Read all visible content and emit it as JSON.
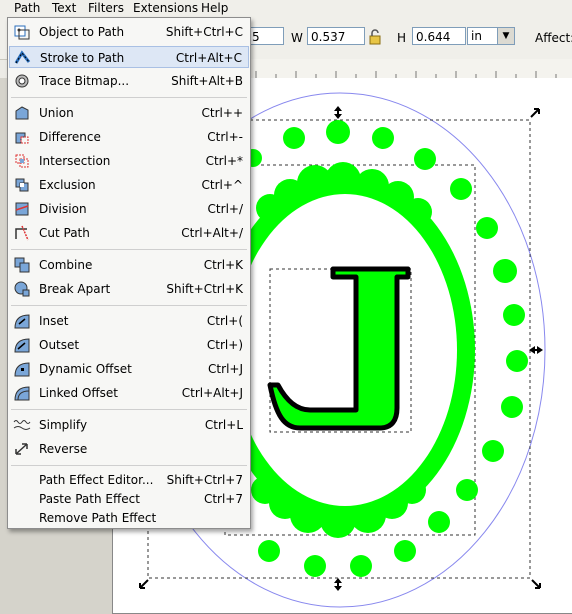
{
  "menubar": {
    "items": [
      {
        "label": "Path",
        "active": true
      },
      {
        "label": "Text"
      },
      {
        "label": "Filters"
      },
      {
        "label": "Extensions"
      },
      {
        "label": "Help"
      }
    ]
  },
  "toolbar": {
    "x_value": "5",
    "w_label": "W",
    "w_value": "0.537",
    "h_label": "H",
    "h_value": "0.644",
    "unit": "in",
    "affect_label": "Affect:"
  },
  "colors": {
    "accent_green": "#00ff00",
    "selection_highlight": "#dde7f5"
  },
  "menu": {
    "items": [
      {
        "label": "Object to Path",
        "shortcut": "Shift+Ctrl+C",
        "icon": "object-to-path-icon"
      },
      {
        "label": "Stroke to Path",
        "shortcut": "Ctrl+Alt+C",
        "icon": "stroke-to-path-icon",
        "highlighted": true
      },
      {
        "label": "Trace Bitmap...",
        "shortcut": "Shift+Alt+B",
        "icon": "trace-bitmap-icon"
      },
      {
        "label": "Union",
        "shortcut": "Ctrl++",
        "icon": "union-icon"
      },
      {
        "label": "Difference",
        "shortcut": "Ctrl+-",
        "icon": "difference-icon"
      },
      {
        "label": "Intersection",
        "shortcut": "Ctrl+*",
        "icon": "intersection-icon"
      },
      {
        "label": "Exclusion",
        "shortcut": "Ctrl+^",
        "icon": "exclusion-icon"
      },
      {
        "label": "Division",
        "shortcut": "Ctrl+/",
        "icon": "division-icon"
      },
      {
        "label": "Cut Path",
        "shortcut": "Ctrl+Alt+/",
        "icon": "cut-path-icon"
      },
      {
        "label": "Combine",
        "shortcut": "Ctrl+K",
        "icon": "combine-icon"
      },
      {
        "label": "Break Apart",
        "shortcut": "Shift+Ctrl+K",
        "icon": "break-apart-icon"
      },
      {
        "label": "Inset",
        "shortcut": "Ctrl+(",
        "icon": "inset-icon"
      },
      {
        "label": "Outset",
        "shortcut": "Ctrl+)",
        "icon": "outset-icon"
      },
      {
        "label": "Dynamic Offset",
        "shortcut": "Ctrl+J",
        "icon": "dynamic-offset-icon"
      },
      {
        "label": "Linked Offset",
        "shortcut": "Ctrl+Alt+J",
        "icon": "linked-offset-icon"
      },
      {
        "label": "Simplify",
        "shortcut": "Ctrl+L",
        "icon": "simplify-icon"
      },
      {
        "label": "Reverse",
        "shortcut": "",
        "icon": "reverse-icon"
      },
      {
        "label": "Path Effect Editor...",
        "shortcut": "Shift+Ctrl+7",
        "icon": ""
      },
      {
        "label": "Paste Path Effect",
        "shortcut": "Ctrl+7",
        "icon": ""
      },
      {
        "label": "Remove Path Effect",
        "shortcut": "",
        "icon": ""
      }
    ]
  }
}
